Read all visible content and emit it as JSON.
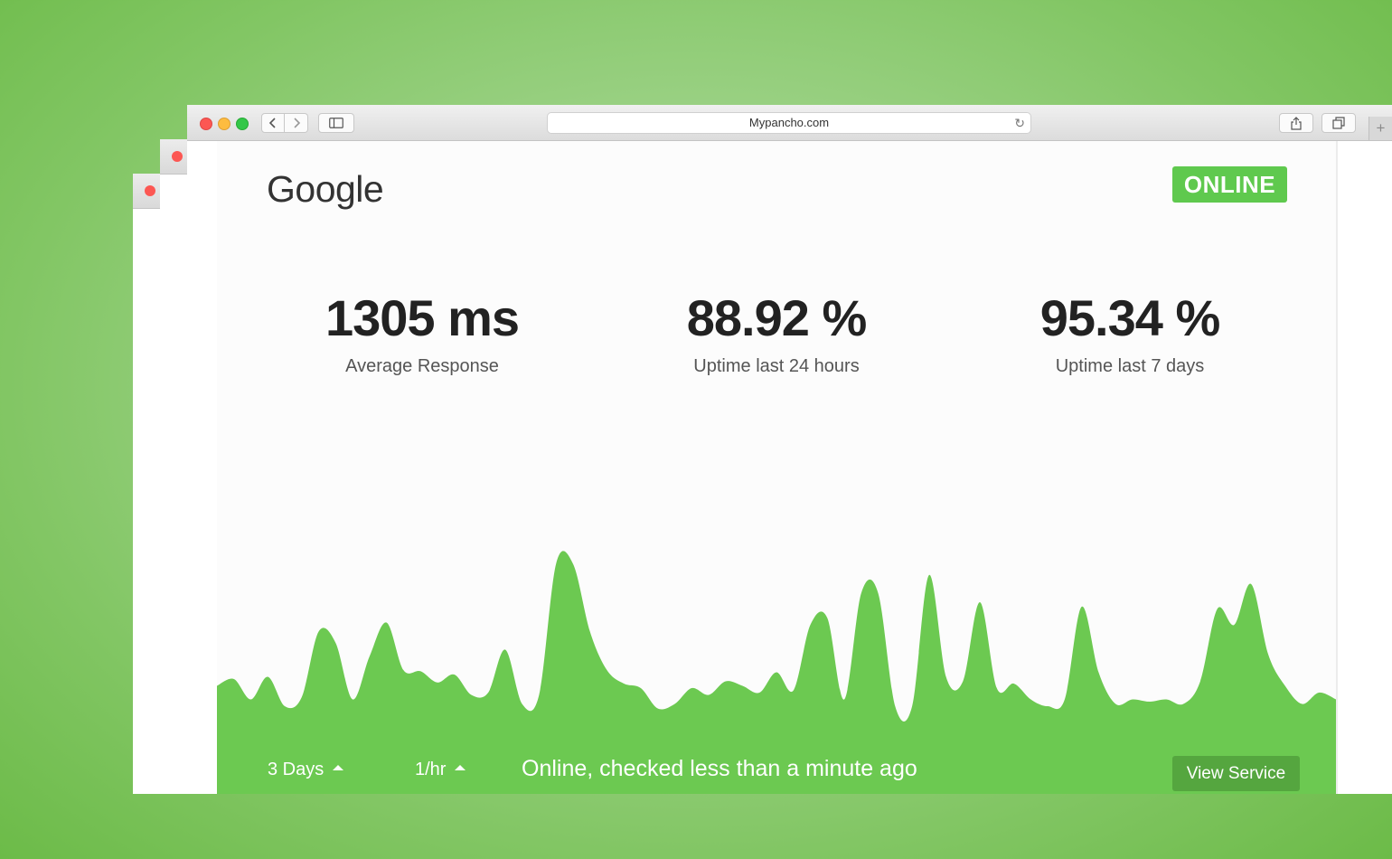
{
  "browser": {
    "url": "Mypancho.com",
    "new_tab": "+"
  },
  "page": {
    "service_name": "Google",
    "status_badge": "ONLINE",
    "stats": [
      {
        "value": "1305 ms",
        "label": "Average Response"
      },
      {
        "value": "88.92 %",
        "label": "Uptime last 24 hours"
      },
      {
        "value": "95.34 %",
        "label": "Uptime last 7 days"
      }
    ],
    "footer": {
      "range": "3 Days",
      "interval": "1/hr",
      "status_text": "Online, checked less than a minute ago",
      "view_button": "View Service"
    }
  },
  "colors": {
    "accent": "#6cc951",
    "badge": "#5fc94e",
    "button": "#55a63f"
  },
  "chart_data": {
    "type": "area",
    "values": [
      22,
      28,
      10,
      30,
      4,
      12,
      70,
      60,
      10,
      48,
      78,
      36,
      35,
      25,
      32,
      14,
      16,
      54,
      6,
      14,
      130,
      130,
      70,
      36,
      24,
      20,
      2,
      6,
      20,
      14,
      26,
      22,
      16,
      34,
      18,
      76,
      82,
      10,
      104,
      104,
      4,
      4,
      120,
      30,
      26,
      96,
      20,
      24,
      10,
      4,
      10,
      92,
      34,
      6,
      10,
      8,
      10,
      6,
      26,
      90,
      76,
      112,
      50,
      22,
      6,
      16,
      10
    ],
    "ylim": [
      0,
      140
    ],
    "color": "#6cc951"
  }
}
